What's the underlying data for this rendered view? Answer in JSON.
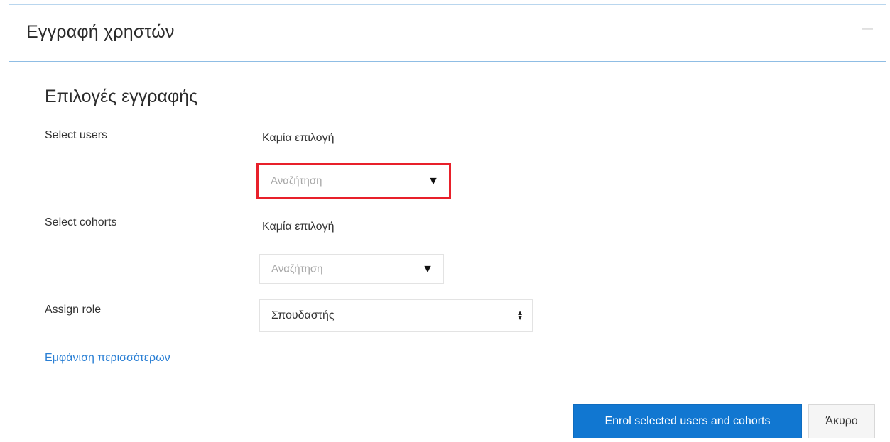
{
  "modal": {
    "title": "Εγγραφή χρηστών",
    "close_icon": "close-icon"
  },
  "section": {
    "title": "Επιλογές εγγραφής"
  },
  "fields": {
    "select_users": {
      "label": "Select users",
      "selection": "Καμία επιλογή",
      "placeholder": "Αναζήτηση",
      "icon": "caret-down-icon"
    },
    "select_cohorts": {
      "label": "Select cohorts",
      "selection": "Καμία επιλογή",
      "placeholder": "Αναζήτηση",
      "icon": "caret-down-icon"
    },
    "assign_role": {
      "label": "Assign role",
      "value": "Σπουδαστής",
      "icon": "select-updown-icon"
    }
  },
  "show_more": {
    "label": "Εμφάνιση περισσότερων"
  },
  "buttons": {
    "enrol_label": "Enrol selected users and cohorts",
    "cancel_label": "Άκυρο"
  },
  "colors": {
    "primary_button": "#1177d1",
    "link": "#2a7fd4",
    "highlight_border": "#e8202a",
    "header_border": "#8fbde4"
  }
}
